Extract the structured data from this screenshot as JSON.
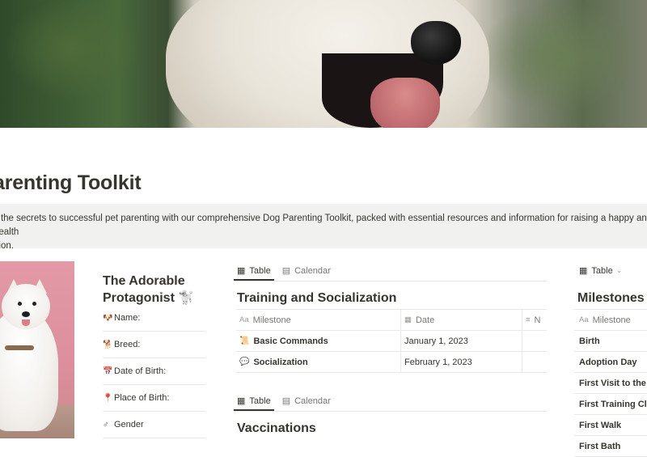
{
  "page": {
    "title": "arenting Toolkit",
    "description": "k the secrets to successful pet parenting with our comprehensive Dog Parenting Toolkit, packed with essential resources and information for raising a happy and health",
    "description_line2": "nion."
  },
  "profile": {
    "title": "The Adorable Protagonist 🐩",
    "fields": [
      {
        "icon": "🐶",
        "label": "Name:"
      },
      {
        "icon": "🐕",
        "label": "Breed:"
      },
      {
        "icon": "📅",
        "label": "Date of Birth:"
      },
      {
        "icon": "📍",
        "label": "Place of Birth:"
      },
      {
        "icon": "♂",
        "label": "Gender"
      }
    ]
  },
  "views": {
    "table_label": "Table",
    "calendar_label": "Calendar"
  },
  "training": {
    "title": "Training and Socialization",
    "columns": [
      {
        "icon": "Aa",
        "label": "Milestone"
      },
      {
        "icon": "▦",
        "label": "Date"
      },
      {
        "icon": "≡",
        "label": "N"
      }
    ],
    "rows": [
      {
        "icon": "📜",
        "name": "Basic Commands",
        "date": "January 1, 2023"
      },
      {
        "icon": "💬",
        "name": "Socialization",
        "date": "February 1, 2023"
      }
    ]
  },
  "vaccinations": {
    "title": "Vaccinations"
  },
  "milestones": {
    "view_label": "Table",
    "title": "Milestones",
    "column": {
      "icon": "Aa",
      "label": "Milestone"
    },
    "rows": [
      "Birth",
      "Adoption Day",
      "First Visit to the V",
      "First Training Cla",
      "First Walk",
      "First Bath"
    ]
  },
  "colors": {
    "text": "#37352f",
    "muted": "#787774",
    "callout_bg": "#f1f1ef",
    "border": "#e9e9e7"
  }
}
